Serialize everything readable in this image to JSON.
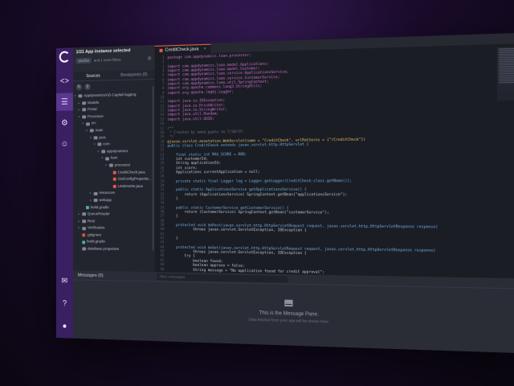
{
  "sidebar": {
    "title": "1/21 App instance selected",
    "filter_chip": "env.fox",
    "filter_more": "and 1 more filters",
    "tabs": [
      "Sources",
      "Breakpoints (0)"
    ],
    "tree": [
      {
        "label": "Appdynamics/AD-Capital-logging",
        "depth": 0,
        "kind": "folder",
        "open": true
      },
      {
        "label": "Models",
        "depth": 1,
        "kind": "folder",
        "open": false
      },
      {
        "label": "Portal",
        "depth": 1,
        "kind": "folder",
        "open": false
      },
      {
        "label": "Processor",
        "depth": 1,
        "kind": "folder",
        "open": true
      },
      {
        "label": "src",
        "depth": 2,
        "kind": "folder",
        "open": true
      },
      {
        "label": "main",
        "depth": 3,
        "kind": "folder",
        "open": true
      },
      {
        "label": "java",
        "depth": 4,
        "kind": "folder",
        "open": true
      },
      {
        "label": "com",
        "depth": 5,
        "kind": "folder",
        "open": true
      },
      {
        "label": "appdynamics",
        "depth": 6,
        "kind": "folder",
        "open": true
      },
      {
        "label": "loan",
        "depth": 7,
        "kind": "folder",
        "open": true
      },
      {
        "label": "processor",
        "depth": 8,
        "kind": "folder",
        "open": true
      },
      {
        "label": "CreditCheck.java",
        "depth": 9,
        "kind": "java"
      },
      {
        "label": "GetConfigPropertie...",
        "depth": 9,
        "kind": "java"
      },
      {
        "label": "Underwrite.java",
        "depth": 9,
        "kind": "java"
      },
      {
        "label": "resources",
        "depth": 4,
        "kind": "folder",
        "open": false
      },
      {
        "label": "webapp",
        "depth": 4,
        "kind": "folder",
        "open": false
      },
      {
        "label": "build.gradle",
        "depth": 2,
        "kind": "gradle"
      },
      {
        "label": "QueueReader",
        "depth": 1,
        "kind": "folder",
        "open": false
      },
      {
        "label": "Rest",
        "depth": 1,
        "kind": "folder",
        "open": false
      },
      {
        "label": "Verification",
        "depth": 1,
        "kind": "folder",
        "open": false
      },
      {
        "label": ".gitignore",
        "depth": 1,
        "kind": "git"
      },
      {
        "label": "build.gradle",
        "depth": 1,
        "kind": "gradle"
      },
      {
        "label": "database.properties",
        "depth": 1,
        "kind": "file"
      }
    ]
  },
  "editor": {
    "tab_label": "CreditCheck.java",
    "lines": [
      "package com.appdynamics.loan.processor;",
      "",
      "import com.appdynamics.loan.model.Applications;",
      "import com.appdynamics.loan.model.Customer;",
      "import com.appdynamics.loan.service.ApplicationsService;",
      "import com.appdynamics.loan.service.CustomerService;",
      "import com.appdynamics.loan.util.SpringContext;",
      "import org.apache.commons.lang3.StringUtils;",
      "import org.apache.log4j.Logger;",
      "",
      "import java.io.IOException;",
      "import java.io.PrintWriter;",
      "import java.io.StringWriter;",
      "import java.util.Random;",
      "import java.util.UUID;",
      "",
      "/**",
      " * Created by amod.gupta on 7/30/15.",
      " */",
      "@javax.servlet.annotation.WebServlet(name = \"CreditCheck\", urlPatterns = {\"/CreditCheck\"})",
      "public class CreditCheck extends javax.servlet.http.HttpServlet {",
      "",
      "    final static int MAX_SCORE = 800;",
      "    int customerId;",
      "    String applicationId;",
      "    int score;",
      "    Applications currentApplication = null;",
      "",
      "    private static final Logger log = Logger.getLogger(CreditCheck.class.getName());",
      "",
      "    public static ApplicationsService getApplicationsService() {",
      "        return (ApplicationsService) SpringContext.getBean(\"applicationsService\");",
      "    }",
      "",
      "    public static CustomerService getCustomerService() {",
      "        return (CustomerService) SpringContext.getBean(\"customerService\");",
      "    }",
      "",
      "    protected void doPost(javax.servlet.http.HttpServletRequest request, javax.servlet.http.HttpServletResponse response)",
      "            throws javax.servlet.ServletException, IOException {",
      "",
      "    }",
      "",
      "    protected void doGet(javax.servlet.http.HttpServletRequest request, javax.servlet.http.HttpServletResponse response)",
      "            throws javax.servlet.ServletException, IOException {",
      "        try {",
      "            boolean found;",
      "            boolean approve = false;",
      "            String message = \"No application found for credit approval\";"
    ]
  },
  "messages": {
    "header": "Messages (0)",
    "filter_placeholder": "Filter messages",
    "empty_title": "This is the Message Pane.",
    "empty_subtitle": "Data fetched from your app will be shown here."
  }
}
